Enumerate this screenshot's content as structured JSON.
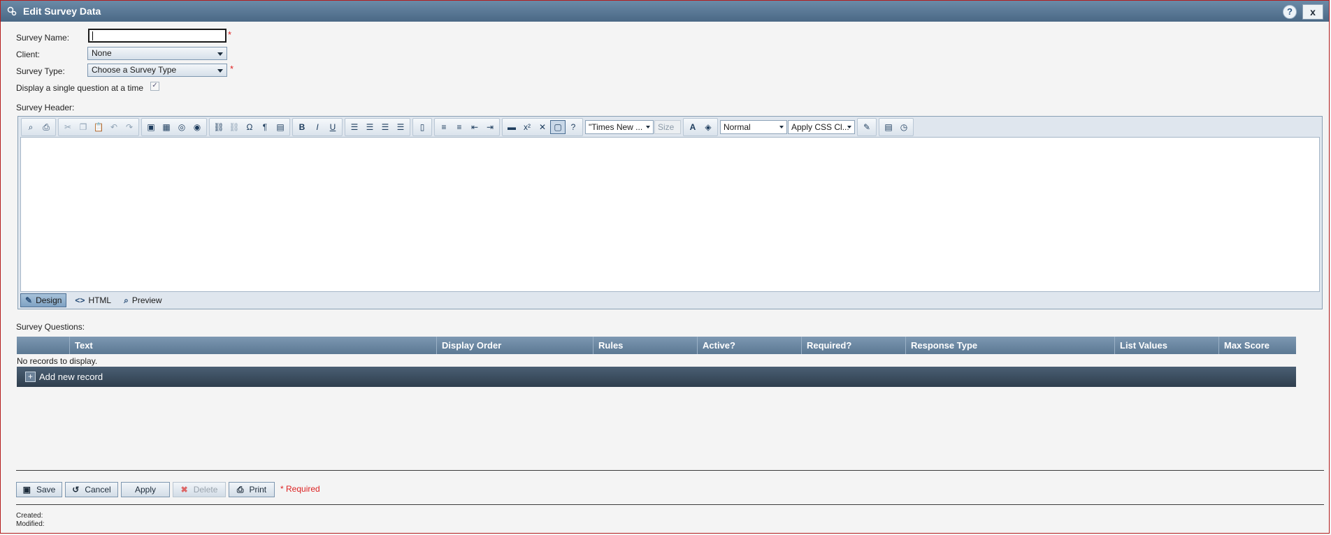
{
  "window": {
    "title": "Edit Survey Data",
    "help_label": "?",
    "close_label": "x"
  },
  "form": {
    "survey_name_label": "Survey Name:",
    "survey_name_value": "",
    "client_label": "Client:",
    "client_value": "None",
    "survey_type_label": "Survey Type:",
    "survey_type_value": "Choose a Survey Type",
    "single_question_label": "Display a single question at a time",
    "single_question_checked": true,
    "survey_header_label": "Survey Header:",
    "required_marker": "*"
  },
  "editor": {
    "font_name": "\"Times New ...",
    "font_size": "Size",
    "paragraph_style": "Normal",
    "css_class": "Apply CSS Cl...",
    "modes": [
      {
        "label": "Design",
        "active": true
      },
      {
        "label": "HTML",
        "active": false
      },
      {
        "label": "Preview",
        "active": false
      }
    ]
  },
  "questions": {
    "label": "Survey Questions:",
    "columns": [
      "",
      "Text",
      "Display Order",
      "Rules",
      "Active?",
      "Required?",
      "Response Type",
      "List Values",
      "Max Score"
    ],
    "empty_message": "No records to display.",
    "add_record_label": "Add new record"
  },
  "actions": {
    "save": "Save",
    "cancel": "Cancel",
    "apply": "Apply",
    "delete": "Delete",
    "print": "Print",
    "required_note": "* Required"
  },
  "meta": {
    "created_label": "Created:",
    "modified_label": "Modified:"
  },
  "colors": {
    "titlebar": "#4a6885",
    "required": "#e02020",
    "grid_header": "#5b7893",
    "grid_footer": "#2f3e4d"
  }
}
